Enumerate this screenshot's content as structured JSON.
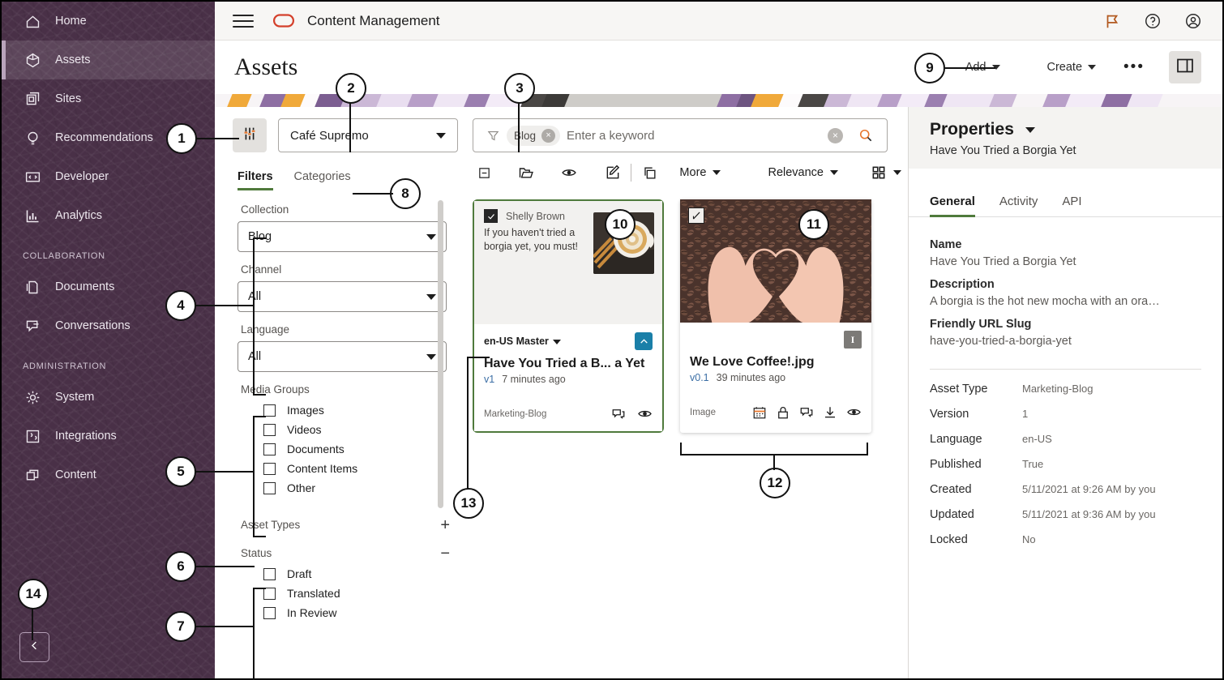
{
  "topbar": {
    "app_title": "Content Management",
    "icons": [
      {
        "name": "flag-icon"
      },
      {
        "name": "help-icon"
      },
      {
        "name": "user-account-icon"
      }
    ]
  },
  "pagehead": {
    "title": "Assets",
    "add_label": "Add",
    "create_label": "Create",
    "more_label": "•••"
  },
  "sidebar": {
    "items": [
      {
        "label": "Home",
        "icon": "home-icon",
        "active": false
      },
      {
        "label": "Assets",
        "icon": "assets-cube-icon",
        "active": true
      },
      {
        "label": "Sites",
        "icon": "sites-icon",
        "active": false
      },
      {
        "label": "Recommendations",
        "icon": "lightbulb-icon",
        "active": false
      },
      {
        "label": "Developer",
        "icon": "code-brackets-icon",
        "active": false
      },
      {
        "label": "Analytics",
        "icon": "bar-chart-icon",
        "active": false
      }
    ],
    "sections": [
      {
        "title": "COLLABORATION",
        "items": [
          {
            "label": "Documents",
            "icon": "documents-icon"
          },
          {
            "label": "Conversations",
            "icon": "conversations-icon"
          }
        ]
      },
      {
        "title": "ADMINISTRATION",
        "items": [
          {
            "label": "System",
            "icon": "gear-icon"
          },
          {
            "label": "Integrations",
            "icon": "puzzle-icon"
          },
          {
            "label": "Content",
            "icon": "content-stack-icon"
          }
        ]
      }
    ],
    "collapse_icon": "chevron-left-icon"
  },
  "filters_panel": {
    "repository": "Café Supremo",
    "sliders_icon": "filter-sliders-icon",
    "tabs": [
      {
        "label": "Filters",
        "active": true
      },
      {
        "label": "Categories",
        "active": false
      }
    ],
    "fields": [
      {
        "label": "Collection",
        "value": "Blog"
      },
      {
        "label": "Channel",
        "value": "All"
      },
      {
        "label": "Language",
        "value": "All"
      }
    ],
    "media_groups": {
      "title": "Media Groups",
      "items": [
        "Images",
        "Videos",
        "Documents",
        "Content Items",
        "Other"
      ]
    },
    "asset_types": {
      "title": "Asset Types",
      "toggle": "+"
    },
    "status": {
      "title": "Status",
      "toggle": "−",
      "items": [
        "Draft",
        "Translated",
        "In Review"
      ]
    }
  },
  "search": {
    "chip_label": "Blog",
    "chip_close": "×",
    "placeholder": "Enter a keyword",
    "clear": "×",
    "search_icon": "magnifier-icon",
    "filter_icon": "funnel-icon"
  },
  "action_toolbar": {
    "icons": [
      {
        "name": "select-all-checkbox-icon"
      },
      {
        "name": "open-folder-icon"
      },
      {
        "name": "eye-preview-icon"
      },
      {
        "name": "edit-pencil-icon"
      },
      {
        "name": "copy-icon"
      }
    ],
    "more_label": "More",
    "sort_label": "Relevance",
    "view_icon": "grid-view-icon"
  },
  "cards": [
    {
      "selected": true,
      "author": "Shelly Brown",
      "excerpt": "If you haven't tried a borgia yet, you must!",
      "language": "en-US Master",
      "title": "Have You Tried a B... a Yet",
      "version": "v1",
      "updated": "7 minutes ago",
      "type": "Marketing-Blog",
      "badge": "published-arrow-badge",
      "footer_icons": [
        {
          "name": "conversation-icon"
        },
        {
          "name": "eye-icon"
        }
      ]
    },
    {
      "selected": false,
      "title": "We Love Coffee!.jpg",
      "version": "v0.1",
      "updated": "39 minutes ago",
      "type": "Image",
      "badge": "I",
      "footer_icons": [
        {
          "name": "calendar-icon"
        },
        {
          "name": "lock-icon"
        },
        {
          "name": "conversation-icon"
        },
        {
          "name": "download-icon"
        },
        {
          "name": "eye-icon"
        }
      ]
    }
  ],
  "properties": {
    "heading": "Properties",
    "subtitle": "Have You Tried a Borgia Yet",
    "tabs": [
      {
        "label": "General",
        "active": true
      },
      {
        "label": "Activity",
        "active": false
      },
      {
        "label": "API",
        "active": false
      }
    ],
    "fields": [
      {
        "label": "Name",
        "value": "Have You Tried a Borgia Yet"
      },
      {
        "label": "Description",
        "value": "A borgia is the hot new mocha with an ora…"
      },
      {
        "label": "Friendly URL Slug",
        "value": "have-you-tried-a-borgia-yet"
      }
    ],
    "table": [
      {
        "key": "Asset Type",
        "value": "Marketing-Blog"
      },
      {
        "key": "Version",
        "value": "1"
      },
      {
        "key": "Language",
        "value": "en-US"
      },
      {
        "key": "Published",
        "value": "True"
      },
      {
        "key": "Created",
        "value": "5/11/2021 at 9:26 AM by you"
      },
      {
        "key": "Updated",
        "value": "5/11/2021 at 9:36 AM by you"
      },
      {
        "key": "Locked",
        "value": "No"
      }
    ]
  },
  "callouts": [
    {
      "n": "1"
    },
    {
      "n": "2"
    },
    {
      "n": "3"
    },
    {
      "n": "4"
    },
    {
      "n": "5"
    },
    {
      "n": "6"
    },
    {
      "n": "7"
    },
    {
      "n": "8"
    },
    {
      "n": "9"
    },
    {
      "n": "10"
    },
    {
      "n": "11"
    },
    {
      "n": "12"
    },
    {
      "n": "13"
    },
    {
      "n": "14"
    }
  ],
  "colors": {
    "sidebar": "#493047",
    "accent_green": "#4f7a3c",
    "accent_orange": "#e8762c",
    "brand_red": "#d4402b",
    "badge_blue": "#1a7fa8"
  }
}
